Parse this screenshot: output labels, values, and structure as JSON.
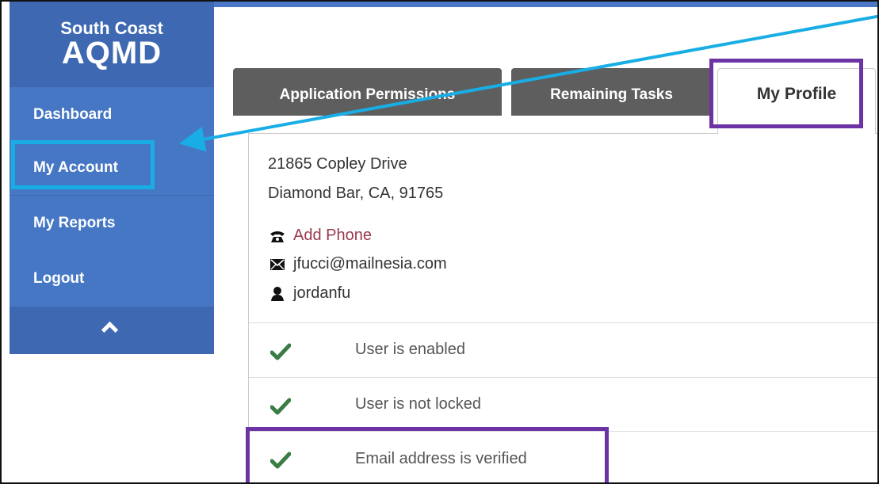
{
  "logo": {
    "line1": "South Coast",
    "line2": "AQMD"
  },
  "sidebar": {
    "items": [
      {
        "label": "Dashboard"
      },
      {
        "label": "My Account"
      },
      {
        "label": "My Reports"
      },
      {
        "label": "Logout"
      }
    ],
    "collapse_icon": "chevron-up-icon"
  },
  "tabs": [
    {
      "label": "Application Permissions"
    },
    {
      "label": "Remaining Tasks"
    },
    {
      "label": "My Profile",
      "active": true
    }
  ],
  "profile": {
    "address_line1": "21865 Copley Drive",
    "address_line2": "Diamond Bar, CA, 91765",
    "phone_link": "Add Phone",
    "email": "jfucci@mailnesia.com",
    "username": "jordanfu"
  },
  "statuses": [
    {
      "label": "User is enabled"
    },
    {
      "label": "User is not locked"
    },
    {
      "label": "Email address is verified"
    }
  ],
  "colors": {
    "sidebar": "#3e69b2",
    "nav_item": "#4677c4",
    "highlight_blue": "#18aee5",
    "highlight_purple": "#6b33a3",
    "check_green": "#3a7d44",
    "link": "#9b3a4d"
  }
}
